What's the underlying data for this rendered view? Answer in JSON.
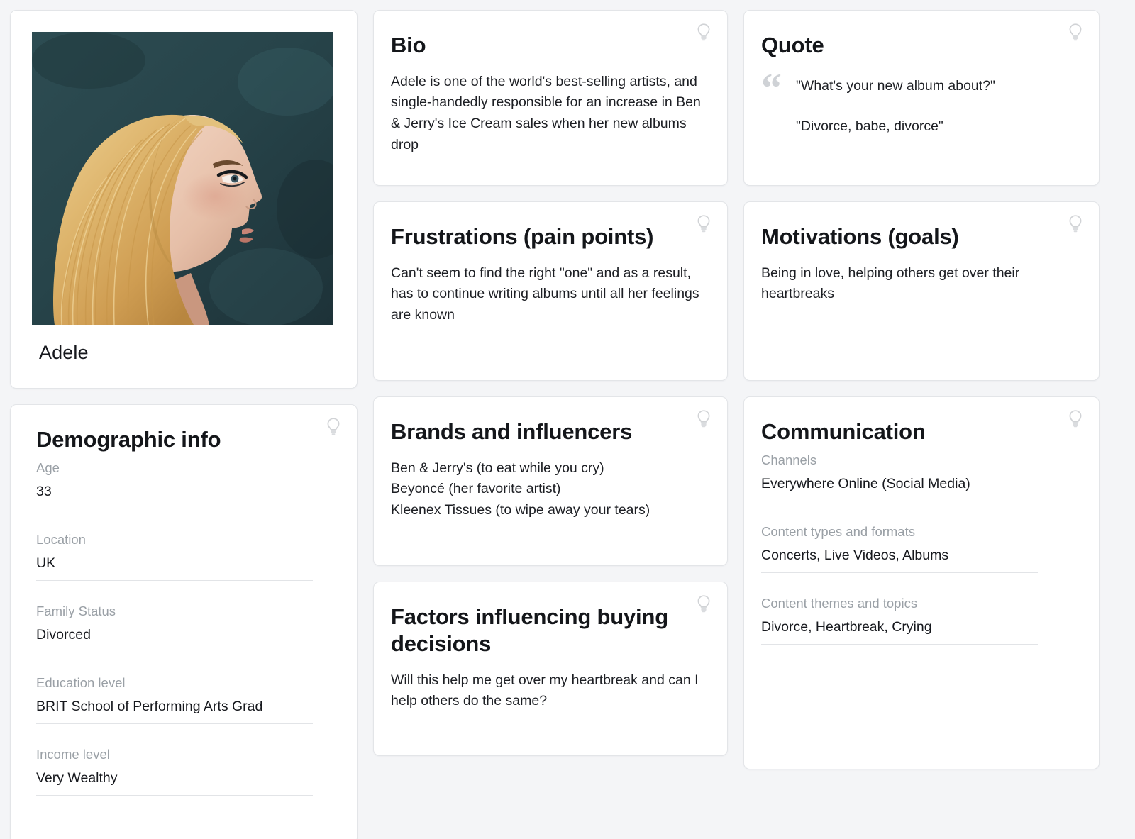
{
  "colors": {
    "page_background": "#f4f5f7",
    "card_background": "#ffffff",
    "card_border": "#e3e5e8",
    "label_gray": "#9aa0a6",
    "text_dark": "#16181d",
    "quote_glyph_gray": "#cfd2d6",
    "bulb_icon_gray": "#c9ccd0",
    "photo_background_teal": "#27444a",
    "hair_blonde": "#d7a85c"
  },
  "icons": {
    "bulb": "lightbulb-icon",
    "quote": "quote-mark-icon"
  },
  "persona": {
    "name": "Adele",
    "photo_alt": "Adele profile portrait"
  },
  "cards": {
    "bio": {
      "title": "Bio",
      "body": "Adele is one of the world's best-selling artists, and single-handedly responsible for an increase in Ben & Jerry's Ice Cream sales when her new albums drop"
    },
    "quote": {
      "title": "Quote",
      "line1": "\"What's your new album about?\"",
      "line2": "\"Divorce, babe, divorce\""
    },
    "frustrations": {
      "title": "Frustrations (pain points)",
      "body": "Can't seem to find the right \"one\" and as a result, has to continue writing albums until all her feelings are known"
    },
    "motivations": {
      "title": "Motivations (goals)",
      "body": "Being in love, helping others get over their heartbreaks"
    },
    "brands": {
      "title": "Brands and influencers",
      "body": "Ben & Jerry's (to eat while you cry)\nBeyoncé (her favorite artist)\nKleenex Tissues (to wipe away your tears)"
    },
    "factors": {
      "title": "Factors influencing buying decisions",
      "body": "Will this help me get over my heartbreak and can I help others do the same?"
    },
    "demographic": {
      "title": "Demographic info",
      "fields": [
        {
          "label": "Age",
          "value": "33"
        },
        {
          "label": "Location",
          "value": "UK"
        },
        {
          "label": "Family Status",
          "value": "Divorced"
        },
        {
          "label": "Education level",
          "value": "BRIT School of Performing Arts Grad"
        },
        {
          "label": "Income level",
          "value": "Very Wealthy"
        }
      ]
    },
    "communication": {
      "title": "Communication",
      "fields": [
        {
          "label": "Channels",
          "value": "Everywhere Online (Social Media)"
        },
        {
          "label": "Content types and formats",
          "value": "Concerts, Live Videos, Albums"
        },
        {
          "label": "Content themes and topics",
          "value": "Divorce, Heartbreak, Crying"
        }
      ]
    }
  }
}
